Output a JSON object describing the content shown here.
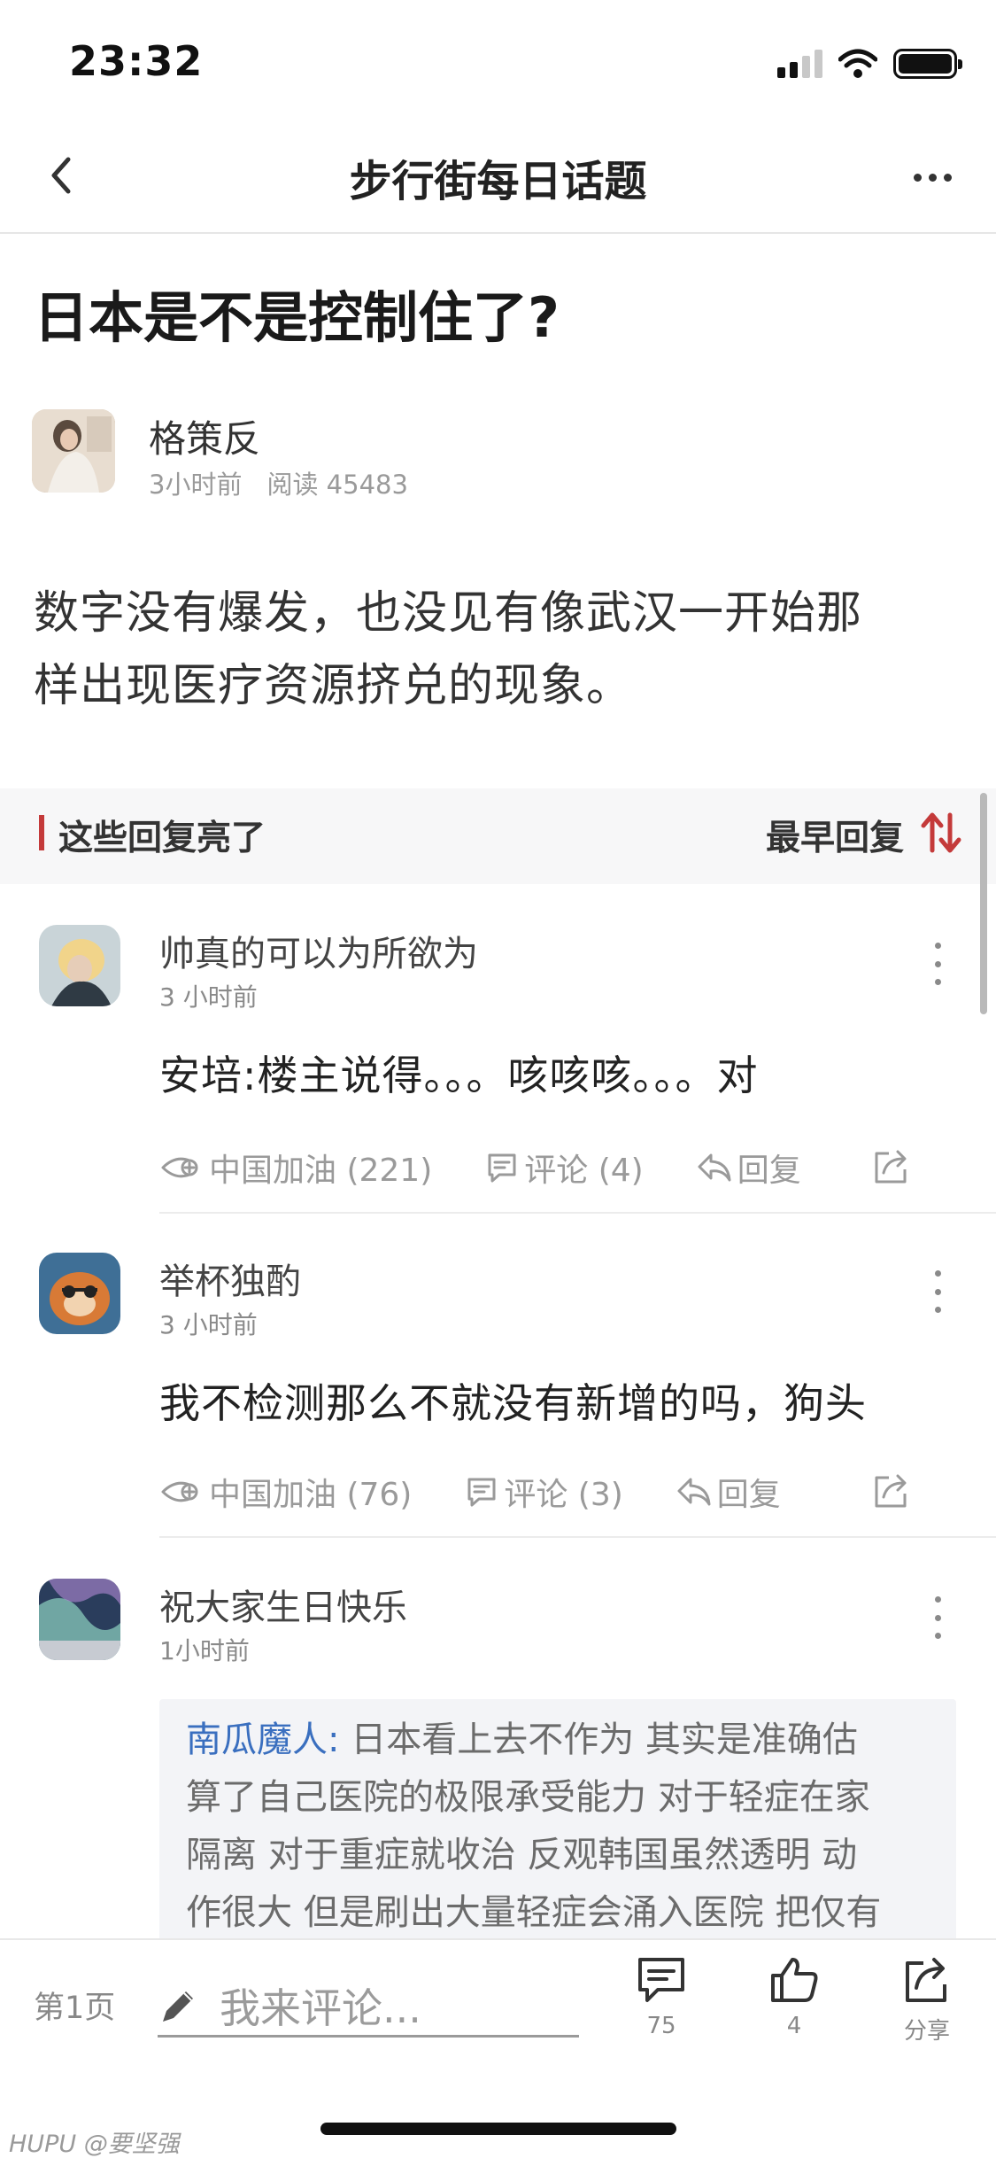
{
  "status": {
    "time": "23:32"
  },
  "nav": {
    "title": "步行街每日话题"
  },
  "post": {
    "title": "日本是不是控制住了?",
    "author": "格策反",
    "time": "3小时前",
    "reads": "阅读 45483",
    "body_line1": "数字没有爆发，也没见有像武汉一开始那",
    "body_line2": "样出现医疗资源挤兑的现象。"
  },
  "section": {
    "title": "这些回复亮了",
    "sort_label": "最早回复",
    "accent": "#c43a3a"
  },
  "comments": [
    {
      "name": "帅真的可以为所欲为",
      "time": "3 小时前",
      "text": "安培:楼主说得。。。咳咳咳。。。对",
      "like": "中国加油 (221)",
      "reply_count": "评论 (4)",
      "reply": "回复"
    },
    {
      "name": "举杯独酌",
      "time": "3 小时前",
      "text": "我不检测那么不就没有新增的吗，狗头",
      "like": "中国加油 (76)",
      "reply_count": "评论 (3)",
      "reply": "回复"
    },
    {
      "name": "祝大家生日快乐",
      "time": "1小时前",
      "quote_name": "南瓜魔人:",
      "quote_line1": " 日本看上去不作为 其实是准确估",
      "quote_line2": "算了自己医院的极限承受能力 对于轻症在家",
      "quote_line3": "隔离 对于重症就收治 反观韩国虽然透明 动",
      "quote_line4": "作很大 但是刷出大量轻症会涌入医院 把仅有"
    }
  ],
  "bottom": {
    "page": "第1页",
    "placeholder": "我来评论...",
    "comments_count": "75",
    "likes_count": "4",
    "share_label": "分享"
  },
  "watermark": "HUPU @要坚强",
  "colors": {
    "link": "#3a6fbf",
    "accent": "#c43a3a"
  }
}
